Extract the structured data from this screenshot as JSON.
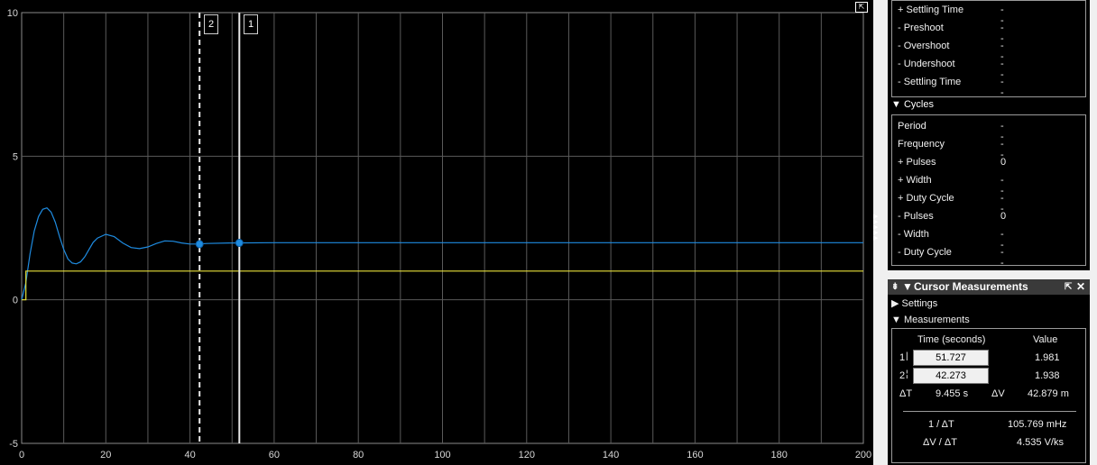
{
  "plot": {
    "y_ticks": [
      "10",
      "5",
      "0",
      "-5"
    ],
    "x_ticks": [
      "0",
      "20",
      "40",
      "60",
      "80",
      "100",
      "120",
      "140",
      "160",
      "180",
      "200"
    ],
    "cursor_labels": [
      "2",
      "1"
    ],
    "undock_icon": "undock-icon",
    "colors": {
      "response": "#1e8be0",
      "reference": "#e8e13a",
      "grid": "#5a5a5a"
    }
  },
  "chart_data": {
    "type": "line",
    "xlim": [
      0,
      200
    ],
    "ylim": [
      -5,
      10
    ],
    "grid": true,
    "series": [
      {
        "x": [
          0,
          1,
          2,
          3,
          4,
          5,
          6,
          7,
          8,
          9,
          10,
          11,
          12,
          13,
          14,
          15,
          16,
          17,
          18,
          20,
          22,
          24,
          26,
          28,
          30,
          32,
          34,
          36,
          38,
          40,
          42,
          44,
          50,
          60,
          80,
          100,
          120,
          140,
          160,
          180,
          200
        ],
        "y": [
          0,
          0.6,
          1.6,
          2.4,
          2.9,
          3.15,
          3.2,
          3.05,
          2.7,
          2.2,
          1.75,
          1.42,
          1.28,
          1.25,
          1.32,
          1.5,
          1.75,
          2.0,
          2.15,
          2.28,
          2.2,
          1.98,
          1.82,
          1.78,
          1.84,
          1.96,
          2.05,
          2.04,
          1.98,
          1.94,
          1.94,
          1.96,
          1.98,
          1.99,
          1.99,
          1.99,
          1.99,
          1.99,
          1.99,
          1.99,
          1.99
        ]
      },
      {
        "x": [
          0,
          1,
          1,
          200
        ],
        "y": [
          0,
          0,
          1,
          1
        ]
      }
    ],
    "cursors": [
      {
        "label": "1",
        "x": 51.727,
        "y": 1.981
      },
      {
        "label": "2",
        "x": 42.273,
        "y": 1.938
      }
    ]
  },
  "signal_stats": {
    "transition_rows": [
      {
        "label": "+ Settling Time",
        "value": "--"
      },
      {
        "label": "- Preshoot",
        "value": "--"
      },
      {
        "label": "- Overshoot",
        "value": "--"
      },
      {
        "label": "- Undershoot",
        "value": "--"
      },
      {
        "label": "- Settling Time",
        "value": "--"
      }
    ],
    "cycles_header": "▼ Cycles",
    "cycles_rows": [
      {
        "label": "Period",
        "value": "--"
      },
      {
        "label": "Frequency",
        "value": "--"
      },
      {
        "label": "+ Pulses",
        "value": "0"
      },
      {
        "label": "+ Width",
        "value": "--"
      },
      {
        "label": "+ Duty Cycle",
        "value": "--"
      },
      {
        "label": "- Pulses",
        "value": "0"
      },
      {
        "label": "- Width",
        "value": "--"
      },
      {
        "label": "- Duty Cycle",
        "value": "--"
      }
    ]
  },
  "cursor_measurements": {
    "title": "Cursor Measurements",
    "pin_icon": "pin-icon",
    "undock_icon": "undock-icon",
    "close_icon": "close-icon",
    "settings_header": "▶ Settings",
    "measurements_header": "▼ Measurements",
    "col_time": "Time (seconds)",
    "col_value": "Value",
    "cursor1_label": "1",
    "cursor1_time": "51.727",
    "cursor1_value": "1.981",
    "cursor2_label": "2",
    "cursor2_time": "42.273",
    "cursor2_value": "1.938",
    "delta_t_label": "ΔT",
    "delta_t_value": "9.455 s",
    "delta_v_label": "ΔV",
    "delta_v_value": "42.879 m",
    "inv_dt_label": "1 / ΔT",
    "inv_dt_value": "105.769 mHz",
    "dv_dt_label": "ΔV / ΔT",
    "dv_dt_value": "4.535 V/ks"
  }
}
